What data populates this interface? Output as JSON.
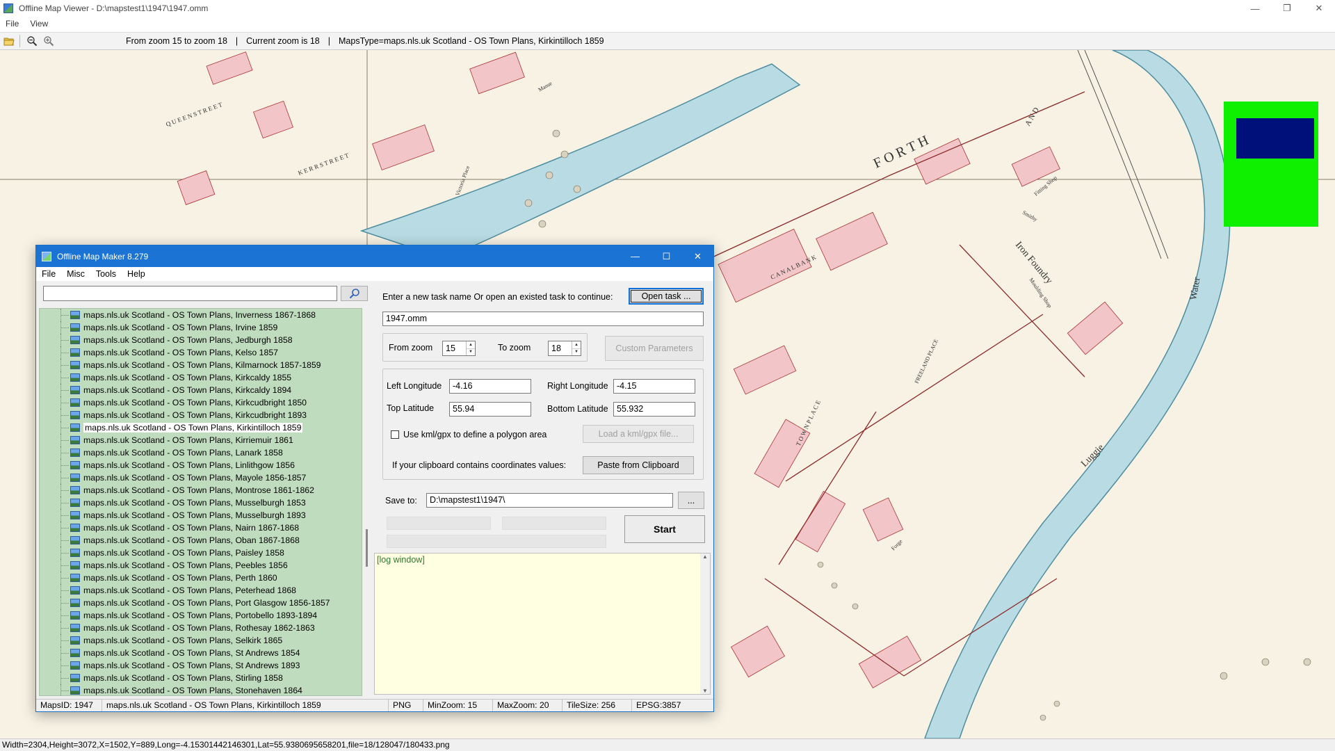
{
  "viewer": {
    "title": "Offline Map Viewer - D:\\mapstest1\\1947\\1947.omm",
    "menu": [
      "File",
      "View"
    ],
    "toolbar": {
      "zoom_range": "From zoom 15 to zoom 18",
      "current_zoom": "Current zoom is 18",
      "maps_type": "MapsType=maps.nls.uk Scotland - OS Town Plans, Kirkintilloch 1859",
      "separator": "|"
    },
    "status": "Width=2304,Height=3072,X=1502,Y=889,Long=-4.15301442146301,Lat=55.9380695658201,file=18/128047/180433.png",
    "overview_colors": {
      "background": "#0ef000",
      "viewport": "#00107a"
    },
    "map_labels": [
      "F O R T H",
      "A N D",
      "Iron Foundry",
      "Moulding Shop",
      "Fitting Shop",
      "Smithy",
      "Water",
      "Luggie",
      "C A N A L   B A N K",
      "T O W N   P L A C E",
      "FREELAND PLACE",
      "K E R R   S T R E E T",
      "Q U E E N   S T R E E T",
      "Manse",
      "Victoria Place",
      "Forge"
    ]
  },
  "dialog": {
    "title": "Offline Map Maker 8.279",
    "menu": [
      "File",
      "Misc",
      "Tools",
      "Help"
    ],
    "search": {
      "value": "",
      "placeholder": ""
    },
    "map_list": [
      "maps.nls.uk Scotland - OS Town Plans, Inverness 1867-1868",
      "maps.nls.uk Scotland - OS Town Plans, Irvine 1859",
      "maps.nls.uk Scotland - OS Town Plans, Jedburgh 1858",
      "maps.nls.uk Scotland - OS Town Plans, Kelso 1857",
      "maps.nls.uk Scotland - OS Town Plans, Kilmarnock 1857-1859",
      "maps.nls.uk Scotland - OS Town Plans, Kirkcaldy 1855",
      "maps.nls.uk Scotland - OS Town Plans, Kirkcaldy 1894",
      "maps.nls.uk Scotland - OS Town Plans, Kirkcudbright 1850",
      "maps.nls.uk Scotland - OS Town Plans, Kirkcudbright 1893",
      "maps.nls.uk Scotland - OS Town Plans, Kirkintilloch 1859",
      "maps.nls.uk Scotland - OS Town Plans, Kirriemuir 1861",
      "maps.nls.uk Scotland - OS Town Plans, Lanark 1858",
      "maps.nls.uk Scotland - OS Town Plans, Linlithgow 1856",
      "maps.nls.uk Scotland - OS Town Plans, Mayole 1856-1857",
      "maps.nls.uk Scotland - OS Town Plans, Montrose 1861-1862",
      "maps.nls.uk Scotland - OS Town Plans, Musselburgh 1853",
      "maps.nls.uk Scotland - OS Town Plans, Musselburgh 1893",
      "maps.nls.uk Scotland - OS Town Plans, Nairn 1867-1868",
      "maps.nls.uk Scotland - OS Town Plans, Oban 1867-1868",
      "maps.nls.uk Scotland - OS Town Plans, Paisley 1858",
      "maps.nls.uk Scotland - OS Town Plans, Peebles 1856",
      "maps.nls.uk Scotland - OS Town Plans, Perth 1860",
      "maps.nls.uk Scotland - OS Town Plans, Peterhead 1868",
      "maps.nls.uk Scotland - OS Town Plans, Port Glasgow 1856-1857",
      "maps.nls.uk Scotland - OS Town Plans, Portobello 1893-1894",
      "maps.nls.uk Scotland - OS Town Plans, Rothesay 1862-1863",
      "maps.nls.uk Scotland - OS Town Plans, Selkirk 1865",
      "maps.nls.uk Scotland - OS Town Plans, St Andrews 1854",
      "maps.nls.uk Scotland - OS Town Plans, St Andrews 1893",
      "maps.nls.uk Scotland - OS Town Plans, Stirling 1858",
      "maps.nls.uk Scotland - OS Town Plans, Stonehaven 1864"
    ],
    "selected_index": 9,
    "task_prompt": "Enter a new task name Or open an existed task to continue:",
    "open_task_label": "Open task ...",
    "task_name": "1947.omm",
    "from_zoom_label": "From zoom",
    "from_zoom": "15",
    "to_zoom_label": "To zoom",
    "to_zoom": "18",
    "custom_params_label": "Custom Parameters",
    "left_lon_label": "Left Longitude",
    "left_lon": "-4.16",
    "right_lon_label": "Right Longitude",
    "right_lon": "-4.15",
    "top_lat_label": "Top Latitude",
    "top_lat": "55.94",
    "bottom_lat_label": "Bottom Latitude",
    "bottom_lat": "55.932",
    "kml_label": "Use kml/gpx to define a polygon area",
    "kml_checked": false,
    "load_kml_label": "Load a kml/gpx file...",
    "clipboard_prompt": "If your clipboard contains coordinates values:",
    "paste_label": "Paste from Clipboard",
    "save_to_label": "Save to:",
    "save_to": "D:\\mapstest1\\1947\\",
    "browse_label": "...",
    "start_label": "Start",
    "log_text": "[log window]",
    "status": {
      "maps_id": "MapsID: 1947",
      "map_name": "maps.nls.uk Scotland - OS Town Plans, Kirkintilloch 1859",
      "format": "PNG",
      "min_zoom": "MinZoom: 15",
      "max_zoom": "MaxZoom: 20",
      "tile_size": "TileSize: 256",
      "epsg": "EPSG:3857"
    }
  }
}
